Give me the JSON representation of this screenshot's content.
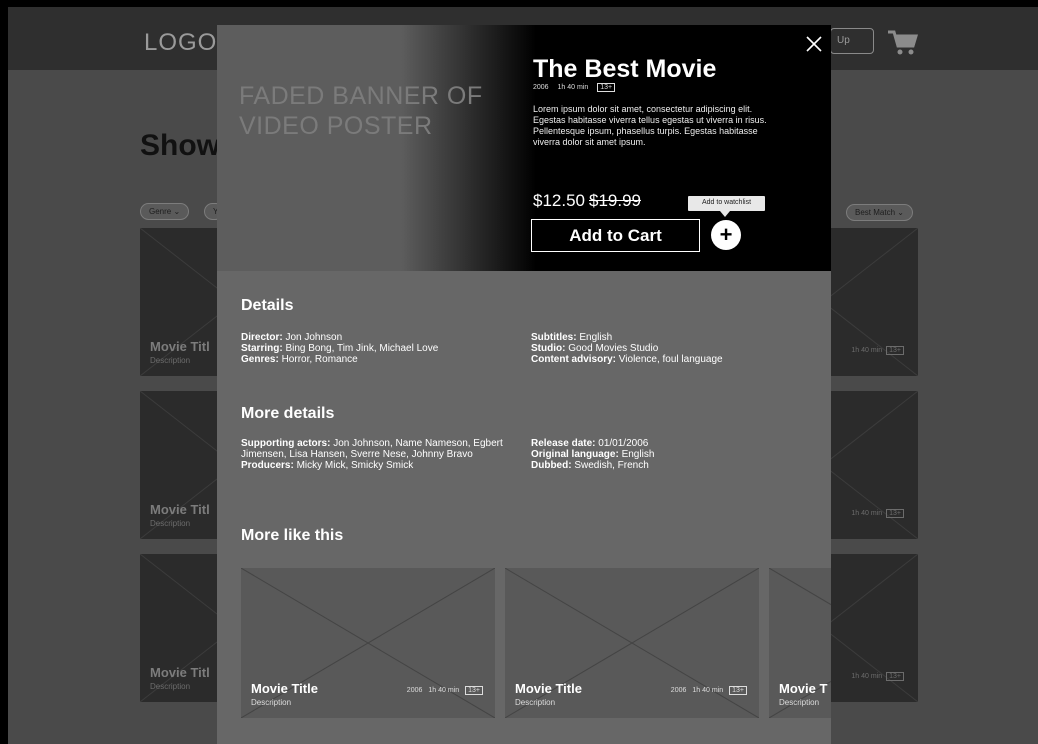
{
  "background": {
    "logo": "LOGO",
    "signup_label": "Up",
    "title": "Show",
    "filters": [
      "Genre ⌄",
      "Y"
    ],
    "sort": "Best Match ⌄",
    "card_title": "Movie Titl",
    "card_desc": "Description",
    "card_duration": "1h 40 min",
    "card_rating": "13+"
  },
  "modal": {
    "banner_text": "FADED BANNER OF VIDEO POSTER",
    "title": "The Best Movie",
    "year": "2006",
    "duration": "1h 40 min",
    "rating": "13+",
    "synopsis": "Lorem ipsum dolor sit amet, consectetur adipiscing elit. Egestas habitasse viverra tellus egestas ut viverra in risus. Pellentesque ipsum, phasellus turpis. Egestas habitasse viverra dolor sit amet ipsum.",
    "price": "$12.50",
    "old_price": "$19.99",
    "add_to_cart": "Add to Cart",
    "watchlist_tooltip": "Add to watchlist",
    "watchlist_icon": "+",
    "details_heading": "Details",
    "details": {
      "director_label": "Director:",
      "director": "Jon Johnson",
      "starring_label": "Starring:",
      "starring": "Bing Bong, Tim Jink, Michael Love",
      "genres_label": "Genres:",
      "genres": "Horror, Romance",
      "subtitles_label": "Subtitles:",
      "subtitles": "English",
      "studio_label": "Studio:",
      "studio": "Good Movies Studio",
      "advisory_label": "Content advisory:",
      "advisory": "Violence, foul language"
    },
    "more_details_heading": "More details",
    "more_details": {
      "supporting_label": "Supporting actors:",
      "supporting": "Jon Johnson, Name Nameson, Egbert Jimensen, Lisa Hansen, Sverre Nese, Johnny Bravo",
      "producers_label": "Producers:",
      "producers": "Micky Mick, Smicky Smick",
      "release_label": "Release date:",
      "release": "01/01/2006",
      "language_label": "Original language:",
      "language": "English",
      "dubbed_label": "Dubbed:",
      "dubbed": "Swedish, French"
    },
    "more_like_heading": "More like this",
    "more_like": [
      {
        "title": "Movie Title",
        "desc": "Description",
        "year": "2006",
        "duration": "1h 40 min",
        "rating": "13+"
      },
      {
        "title": "Movie Title",
        "desc": "Description",
        "year": "2006",
        "duration": "1h 40 min",
        "rating": "13+"
      },
      {
        "title": "Movie T",
        "desc": "Description"
      }
    ]
  },
  "icons": {
    "close": "close-icon",
    "cart": "cart-icon",
    "watchlist": "plus-icon"
  }
}
